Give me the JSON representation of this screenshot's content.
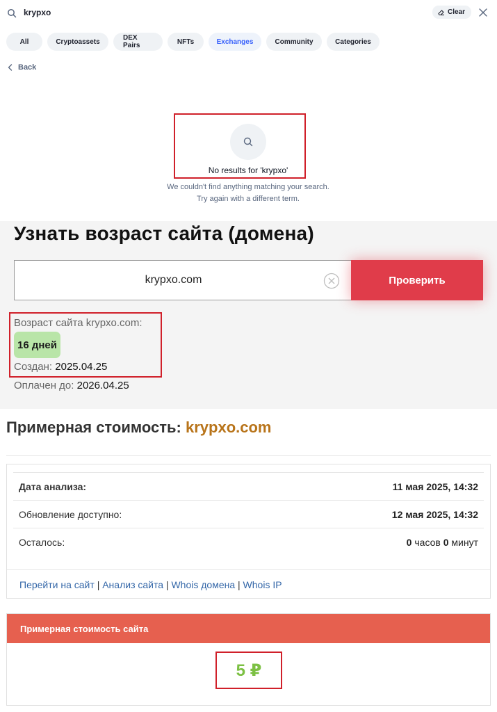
{
  "search": {
    "query": "krypxo",
    "clear_label": "Clear",
    "filters": [
      "All",
      "Cryptoassets",
      "DEX Pairs",
      "NFTs",
      "Exchanges",
      "Community",
      "Categories"
    ],
    "active_filter": "Exchanges",
    "back_label": "Back",
    "empty_title": "No results for 'krypxo'",
    "empty_line1": "We couldn't find anything matching your search.",
    "empty_line2": "Try again with a different term."
  },
  "age_checker": {
    "title": "Узнать возраст сайта (домена)",
    "input_value": "krypxo.com",
    "button_label": "Проверить",
    "age_label": "Возраст сайта krypxo.com:",
    "age_value": "16 дней",
    "created_label": "Создан:",
    "created_value": "2025.04.25",
    "paid_label": "Оплачен до:",
    "paid_value": "2026.04.25"
  },
  "estimate": {
    "title_prefix": "Примерная стоимость:",
    "title_domain": "krypxo.com",
    "rows": [
      {
        "key": "Дата анализа:",
        "value": "11 мая 2025, 14:32"
      },
      {
        "key": "Обновление доступно:",
        "value": "12 мая 2025, 14:32"
      }
    ],
    "remaining_key": "Осталось:",
    "remaining_hours": "0",
    "remaining_hours_unit": "часов",
    "remaining_minutes": "0",
    "remaining_minutes_unit": "минут",
    "links": [
      "Перейти на сайт",
      "Анализ сайта",
      "Whois домена",
      "Whois IP"
    ],
    "link_separator": "|",
    "price_header": "Примерная стоимость сайта",
    "price_value": "5 ₽"
  },
  "colors": {
    "highlight_box": "#d0202a",
    "check_button": "#e03c4a",
    "age_badge": "#b9e5a8",
    "price_header": "#e6604f",
    "price_value": "#7cc043",
    "domain_accent": "#b8741a",
    "link": "#3467a8",
    "active_filter": "#3861fb"
  },
  "icons": {
    "search": "search-icon",
    "clear": "eraser-icon",
    "close": "close-icon",
    "back": "chevron-left-icon",
    "empty": "search-icon",
    "input_clear": "circle-x-icon"
  }
}
